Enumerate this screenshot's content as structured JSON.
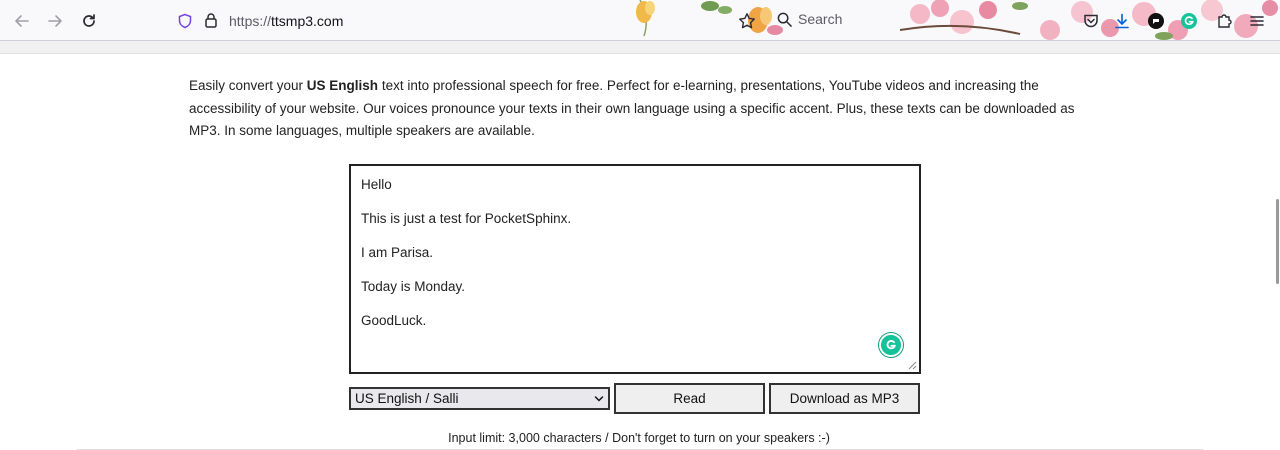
{
  "browser": {
    "url_protocol": "https://",
    "url_host": "ttsmp3.com",
    "search_label": "Search"
  },
  "page": {
    "intro_before": "Easily convert your ",
    "intro_bold": "US English",
    "intro_after": " text into professional speech for free. Perfect for e-learning, presentations, YouTube videos and increasing the accessibility of your website. Our voices pronounce your texts in their own language using a specific accent. Plus, these texts can be downloaded as MP3. In some languages, multiple speakers are available.",
    "text_lines": [
      "Hello",
      "This is just a test for PocketSphinx.",
      "I am Parisa.",
      "Today is Monday.",
      "GoodLuck."
    ],
    "voice_selected": "US English / Salli",
    "read_label": "Read",
    "download_label": "Download as MP3",
    "hint": "Input limit: 3,000 characters / Don't forget to turn on your speakers :-)"
  },
  "colors": {
    "grammarly": "#15c39a",
    "download_icon": "#0060df",
    "shield_icon": "#7542e5"
  }
}
